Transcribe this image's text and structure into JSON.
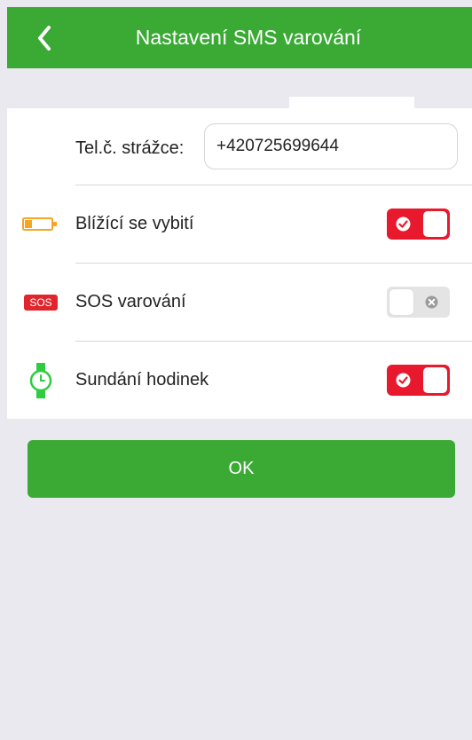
{
  "header": {
    "title": "Nastavení SMS varování",
    "back_icon": "chevron-left-icon",
    "color": "#3aaa35"
  },
  "guardian": {
    "label": "Tel.č. strážce:",
    "value": "+420725699644"
  },
  "settings": [
    {
      "label": "Blížící se vybití",
      "icon": "low-battery-icon",
      "enabled": true
    },
    {
      "label": "SOS varování",
      "icon": "sos-icon",
      "icon_text": "SOS",
      "enabled": false
    },
    {
      "label": "Sundání hodinek",
      "icon": "watch-icon",
      "enabled": true
    }
  ],
  "colors": {
    "toggle_on": "#e8192c",
    "toggle_off": "#e4e4e4",
    "accent": "#3aaa35"
  },
  "ok_label": "OK"
}
